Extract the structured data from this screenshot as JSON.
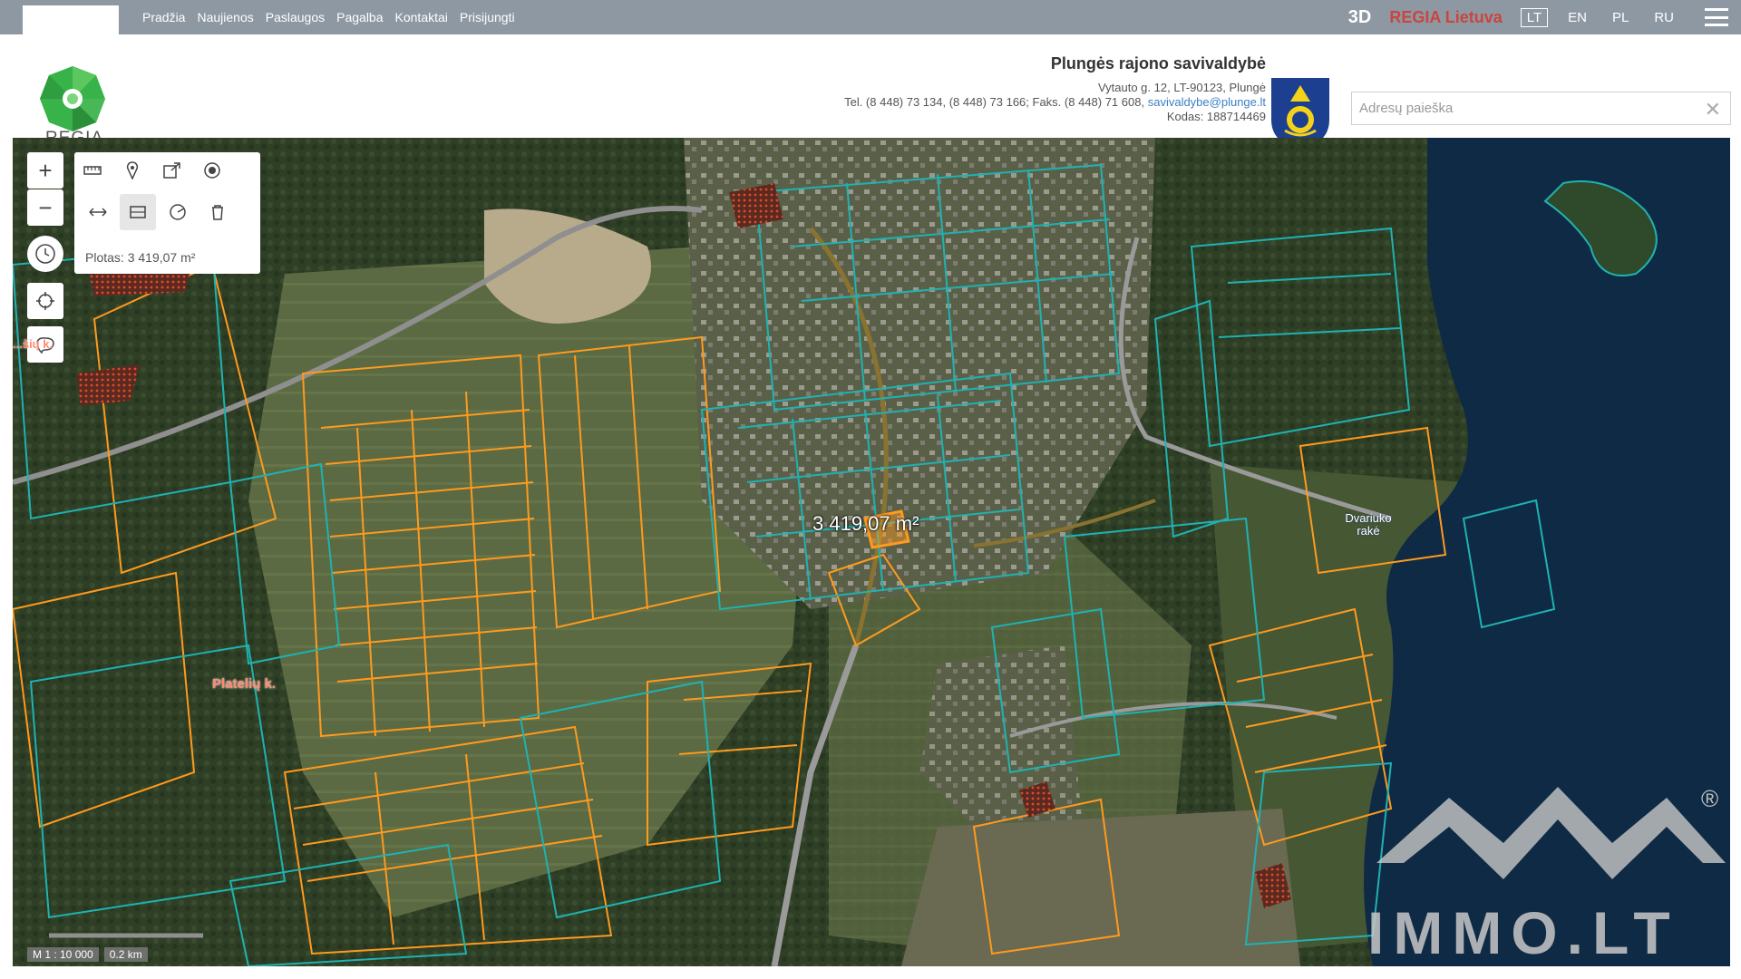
{
  "nav": {
    "items": [
      "Pradžia",
      "Naujienos",
      "Paslaugos",
      "Pagalba",
      "Kontaktai",
      "Prisijungti"
    ],
    "btn_3d": "3D",
    "regia_lietuva": "REGIA Lietuva",
    "languages": [
      "LT",
      "EN",
      "PL",
      "RU"
    ],
    "active_language": "LT"
  },
  "header": {
    "logo_text": "REGIA",
    "municipality": {
      "title": "Plungės rajono savivaldybė",
      "address": "Vytauto g. 12, LT-90123, Plungė",
      "contacts": "Tel. (8 448) 73 134, (8 448) 73 166; Faks. (8 448) 71 608,",
      "email": "savivaldybe@plunge.lt",
      "code": "Kodas: 188714469"
    },
    "search": {
      "placeholder": "Adresų paieška",
      "value": ""
    }
  },
  "map": {
    "area_panel_text": "Plotas: 3 419,07 m²",
    "measure_label": "3 419,07 m²",
    "place_labels": {
      "town": "Platelių k.",
      "village_left": "...šių k.",
      "lake": "Dvariuko\nrakė"
    },
    "scale": {
      "ratio": "M 1 : 10 000",
      "distance": "0.2 km"
    },
    "watermark": "IMMO.LT",
    "registered": "®"
  },
  "colors": {
    "topbar": "#8e98a3",
    "regia_red": "#c9453f",
    "parcel_orange": "#ff9a1e",
    "parcel_teal": "#1fb2b2",
    "lake": "#0f2a44"
  }
}
